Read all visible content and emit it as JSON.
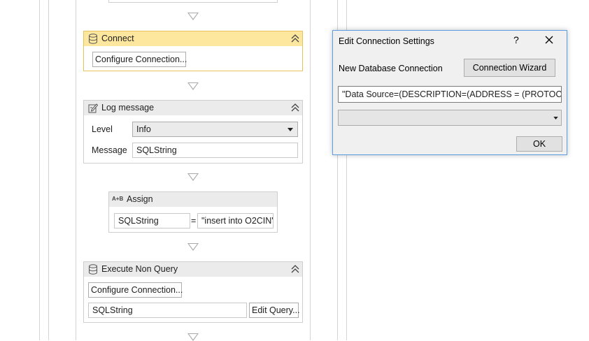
{
  "workflow": {
    "connect": {
      "title": "Connect",
      "configure_label": "Configure Connection..."
    },
    "log_message": {
      "title": "Log message",
      "level_label": "Level",
      "level_value": "Info",
      "message_label": "Message",
      "message_value": "SQLString"
    },
    "assign": {
      "title": "Assign",
      "icon_text": "A+B",
      "target": "SQLString",
      "equals": "=",
      "value": "\"insert into O2CIN'"
    },
    "execute_non_query": {
      "title": "Execute Non Query",
      "configure_label": "Configure Connection...",
      "sql_value": "SQLString",
      "edit_query_label": "Edit Query..."
    }
  },
  "dialog": {
    "title": "Edit Connection Settings",
    "help": "?",
    "new_connection_label": "New Database Connection",
    "wizard_button": "Connection Wizard",
    "connection_string": "\"Data Source=(DESCRIPTION=(ADDRESS = (PROTOCOL =",
    "provider_value": "",
    "ok_button": "OK"
  },
  "colors": {
    "selected_header": "#fde79f",
    "selected_border": "#e8c25a",
    "dialog_border": "#5c9ee3",
    "card_header": "#ebebeb"
  }
}
